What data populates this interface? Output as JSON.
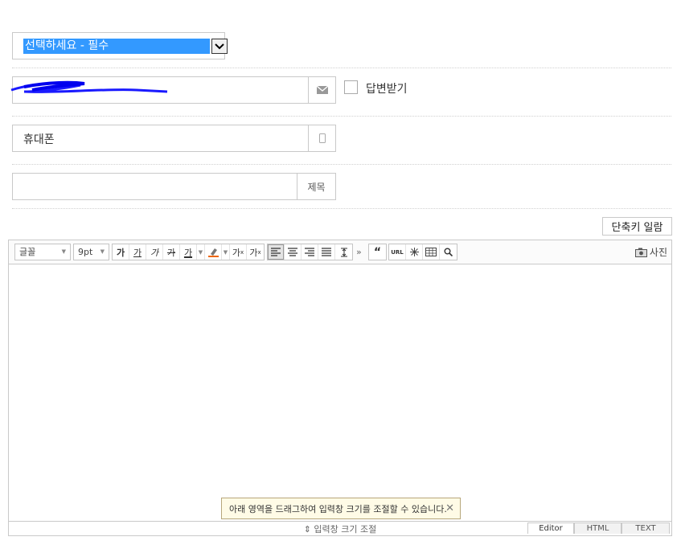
{
  "category": {
    "selected": "선택하세요 - 필수"
  },
  "email": {
    "value": "",
    "icon": "envelope-icon"
  },
  "reply": {
    "label": "답변받기",
    "checked": false
  },
  "phone": {
    "value": "휴대폰",
    "icon": "phone-icon"
  },
  "subject": {
    "value": "",
    "label": "제목"
  },
  "shortcut_button": "단축키 일람",
  "toolbar": {
    "font_label": "글꼴",
    "size_label": "9pt",
    "format_buttons": [
      "가",
      "가",
      "가",
      "가",
      "가"
    ],
    "superscript": "가",
    "subscript": "가",
    "superscript_mark": "x",
    "subscript_mark": "x",
    "more": "»",
    "quote": "“",
    "url": "URL",
    "photo_label": "사진"
  },
  "tooltip": {
    "text": "아래 영역을 드래그하여 입력창 크기를 조절할 수 있습니다.",
    "close": "✕"
  },
  "resize_bar": "⇕ 입력창 크기 조절",
  "mode_tabs": [
    "Editor",
    "HTML",
    "TEXT"
  ],
  "colors": {
    "selection": "#3399ff",
    "border": "#c9c9c9",
    "tooltip_bg": "#fffbe6"
  }
}
